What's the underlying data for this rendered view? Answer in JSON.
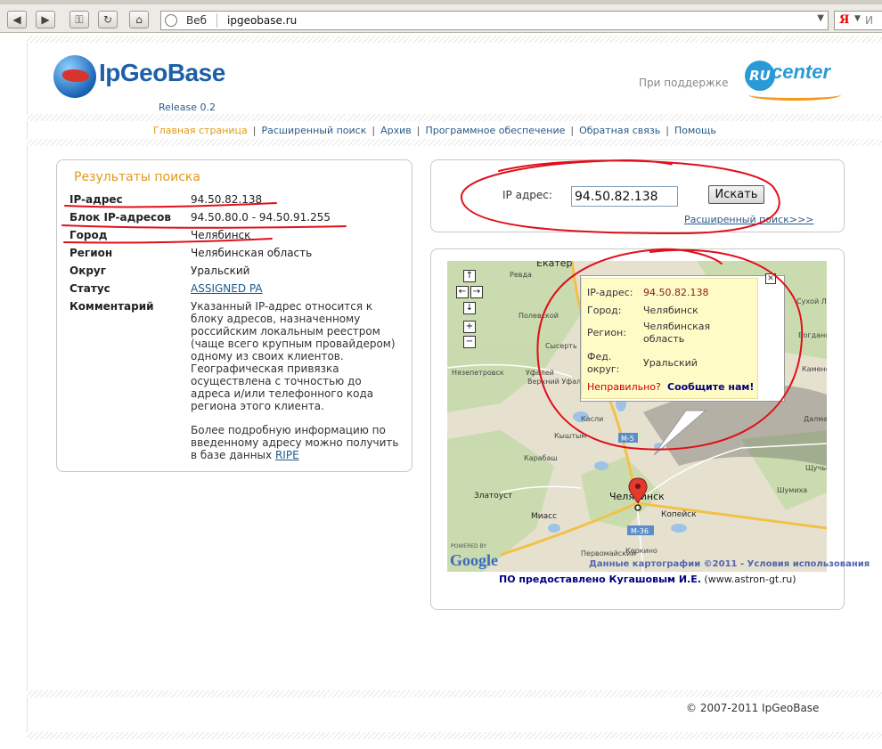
{
  "browser": {
    "address_mode": "Веб",
    "url": "ipgeobase.ru",
    "search_engine_logo": "Я",
    "search_placeholder": "И"
  },
  "header": {
    "logo_text": "IpGeoBase",
    "release": "Release 0.2",
    "support_text": "При поддержке",
    "sponsor_badge": "RU",
    "sponsor_text": "center"
  },
  "nav": {
    "items": [
      "Главная страница",
      "Расширенный поиск",
      "Архив",
      "Программное обеспечение",
      "Обратная связь",
      "Помощь"
    ],
    "active_index": 0
  },
  "results": {
    "title": "Результаты поиска",
    "rows": [
      {
        "label": "IP-адрес",
        "value": "94.50.82.138"
      },
      {
        "label": "Блок IP-адресов",
        "value": "94.50.80.0 - 94.50.91.255"
      },
      {
        "label": "Город",
        "value": "Челябинск"
      },
      {
        "label": "Регион",
        "value": "Челябинская область"
      },
      {
        "label": "Округ",
        "value": "Уральский"
      },
      {
        "label": "Статус",
        "value": "ASSIGNED PA"
      },
      {
        "label": "Комментарий",
        "value": ""
      }
    ],
    "comment": "Указанный IP-адрес относится к блоку адресов, назначенному российским локальным реестром (чаще всего крупным провайдером) одному из своих клиентов. Географическая привязка осуществлена с точностью до адреса и/или телефонного кода региона этого клиента.",
    "more_info": "Более подробную информацию по введенному адресу можно получить в базе данных",
    "more_info_link": "RIPE"
  },
  "search": {
    "label": "IP адрес:",
    "value": "94.50.82.138",
    "button": "Искать",
    "advanced_link": "Расширенный поиск>>>"
  },
  "map": {
    "towns": [
      "Екатер",
      "Ревда",
      "Полевской",
      "Сысерть",
      "Нязепетровск",
      "Уфалей",
      "Верхний Уфалей",
      "Касли",
      "Кыштым",
      "Карабаш",
      "Миасс",
      "Златоуст",
      "Челябинск",
      "Копейск",
      "Коркино",
      "Первомайский",
      "Шумиха",
      "Сухой Лог",
      "Богданович",
      "Каменск-Уральский",
      "Далматово",
      "Щучье"
    ],
    "roads": [
      "M-5",
      "M-36"
    ],
    "popup": {
      "rows": [
        {
          "label": "IP-адрес:",
          "value": "94.50.82.138"
        },
        {
          "label": "Город:",
          "value": "Челябинск"
        },
        {
          "label": "Регион:",
          "value": "Челябинская область"
        },
        {
          "label": "Фед. округ:",
          "value": "Уральский"
        }
      ],
      "wrong": "Неправильно?",
      "report": "Сообщите нам!"
    },
    "attribution": "Данные картографии ©2011 - Условия использования",
    "powered_by": "POWERED BY",
    "google_logo": "Google"
  },
  "credit": {
    "bold": "ПО предоставлено Кугашовым И.Е.",
    "rest": " (www.astron-gt.ru)"
  },
  "footer": "© 2007-2011 IpGeoBase",
  "colors": {
    "accent_orange": "#e29a16",
    "link_blue": "#2a5a8a",
    "annotation_red": "#e0101a",
    "popup_bg": "#fffbc7"
  }
}
